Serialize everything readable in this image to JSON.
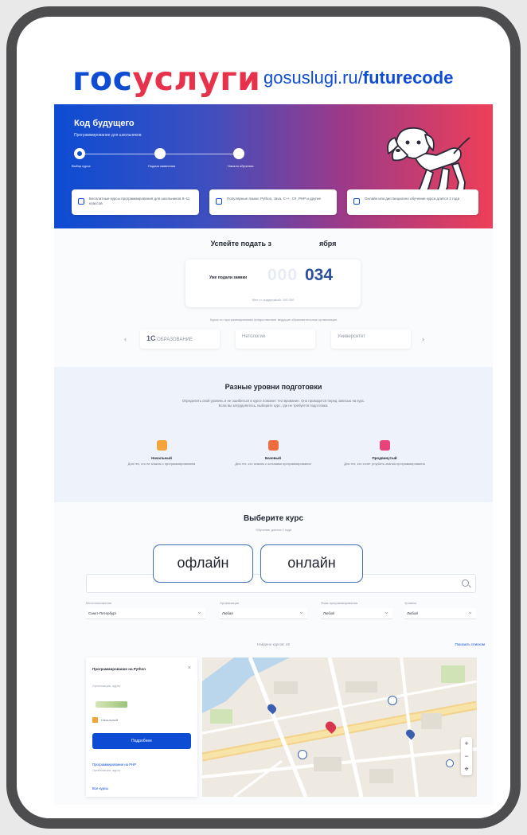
{
  "brand": {
    "logo_part1": "гос",
    "logo_part2": "услуги",
    "url_prefix": "gosuslugi.ru/",
    "url_bold": "futurecode",
    "colors": {
      "blue": "#0d4cd3",
      "red": "#e8324c",
      "frame": "#4d4d4f"
    }
  },
  "hero": {
    "title": "Код будущего",
    "subtitle": "Программирование для школьников",
    "steps": [
      "Выбор курса",
      "Подача заявления",
      "Начало обучения"
    ]
  },
  "features": [
    {
      "icon": "code-icon",
      "text": "Бесплатные курсы программирования для школьников 8–11 классов"
    },
    {
      "icon": "book-icon",
      "text": "Популярные языки: Python, Java, C++, C#, PHP и другие"
    },
    {
      "icon": "clock-icon",
      "text": "Онлайн или дистанционно обучение курса длится 2 года"
    }
  ],
  "countdown": {
    "title_left": "Успейте подать з",
    "title_right": "ября",
    "label": "Уже подали заявки",
    "zeros": "000",
    "number": "034",
    "footnote": "Мест с поддержкой: 100 000"
  },
  "partners": {
    "note": "Курсы по программированию предоставляют ведущие образовательные организации",
    "items": [
      {
        "bold": "1С",
        "rest": " ОБРАЗОВАНИЕ"
      },
      {
        "bold": "",
        "rest": "Нетология"
      },
      {
        "bold": "",
        "rest": "Университет"
      }
    ],
    "prev": "‹",
    "next": "›"
  },
  "levels": {
    "title": "Разные уровни подготовки",
    "description": "Определить свой уровень и не ошибиться в курсе поможет тестирование. Оно проводится перед записью на курс. Если вы затрудняетесь, выберите курс, где не требуется подготовка.",
    "items": [
      {
        "name": "Начальный",
        "desc": "Для тех, кто не знаком с программированием",
        "color": "#f3a43b"
      },
      {
        "name": "Базовый",
        "desc": "Для тех, кто знаком с основами программирования",
        "color": "#f06b3e"
      },
      {
        "name": "Продвинутый",
        "desc": "Для тех, кто хочет углубить знания программирования",
        "color": "#e8427a"
      }
    ]
  },
  "course": {
    "title": "Выберите курс",
    "subtitle": "Обучение длится 2 года",
    "modes": [
      "офлайн",
      "онлайн"
    ],
    "filters": [
      {
        "label": "Местоположение",
        "value": "Санкт-Петербург"
      },
      {
        "label": "Организация",
        "value": "Любая"
      },
      {
        "label": "Язык программирования",
        "value": "Любой"
      },
      {
        "label": "Уровень",
        "value": "Любой"
      }
    ],
    "found": "Найдено курсов: 46",
    "show_list": "Показать списком"
  },
  "result": {
    "title": "Программирование на Python",
    "meta": "Организация, адрес",
    "badge": "Начальный",
    "button": "Подробнее",
    "title2": "Программирование на PHP",
    "meta2": "Организация, адрес",
    "all": "Все курсы"
  }
}
